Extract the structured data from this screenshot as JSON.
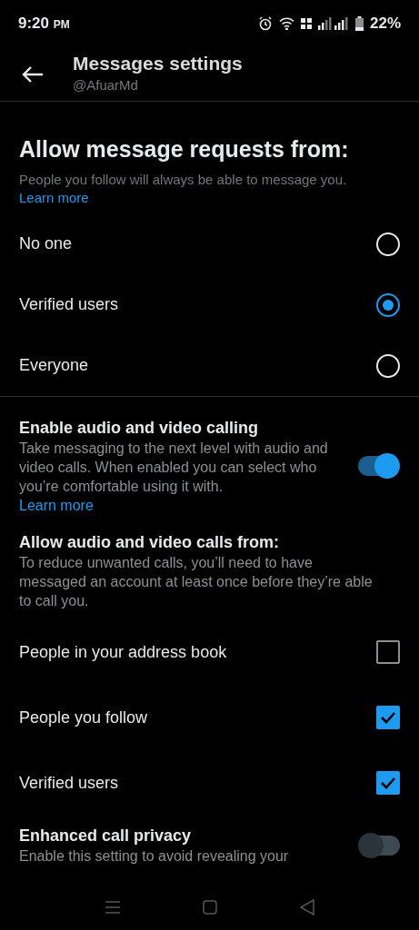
{
  "status_bar": {
    "time": "9:20",
    "ampm": "PM",
    "battery": "22%"
  },
  "header": {
    "title": "Messages settings",
    "subtitle": "@AfuarMd"
  },
  "requests": {
    "title": "Allow message requests from:",
    "description": "People you follow will always be able to message you.",
    "link": "Learn more",
    "options": [
      {
        "label": "No one",
        "selected": false
      },
      {
        "label": "Verified users",
        "selected": true
      },
      {
        "label": "Everyone",
        "selected": false
      }
    ]
  },
  "calling": {
    "title": "Enable audio and video calling",
    "description": "Take messaging to the next level with audio and video calls. When enabled you can select who you’re comfortable using it with.",
    "link": "Learn more",
    "on": true
  },
  "calls_from": {
    "title": "Allow audio and video calls from:",
    "description": "To reduce unwanted calls, you’ll need to have messaged an account at least once before they’re able to call you.",
    "options": [
      {
        "label": "People in your address book",
        "checked": false
      },
      {
        "label": "People you follow",
        "checked": true
      },
      {
        "label": "Verified users",
        "checked": true
      }
    ]
  },
  "privacy": {
    "title": "Enhanced call privacy",
    "description": "Enable this setting to avoid revealing your",
    "on": false
  }
}
